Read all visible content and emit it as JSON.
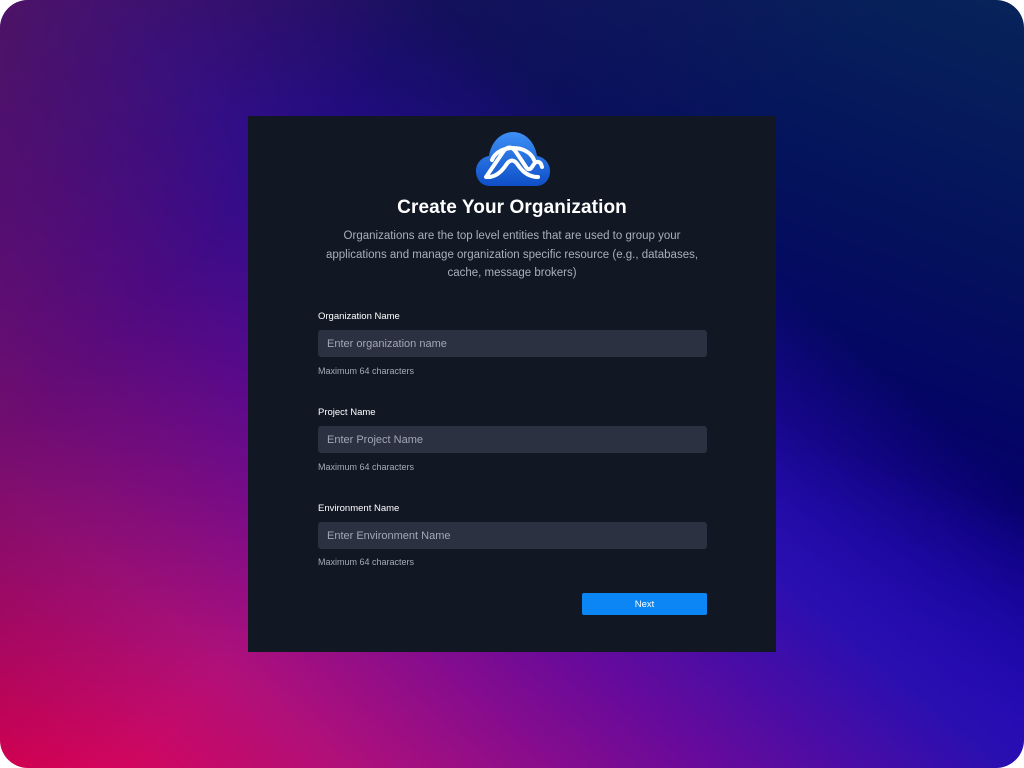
{
  "dialog": {
    "title": "Create Your Organization",
    "description": "Organizations are the top level entities that are used to group your applications and manage organization specific resource (e.g., databases, cache, message brokers)",
    "logo_icon": "cloud-logo-icon"
  },
  "form": {
    "fields": [
      {
        "label": "Organization Name",
        "placeholder": "Enter organization name",
        "value": "",
        "hint": "Maximum 64 characters"
      },
      {
        "label": "Project Name",
        "placeholder": "Enter Project Name",
        "value": "",
        "hint": "Maximum 64 characters"
      },
      {
        "label": "Environment Name",
        "placeholder": "Enter Environment Name",
        "value": "",
        "hint": "Maximum 64 characters"
      }
    ],
    "next_label": "Next"
  },
  "colors": {
    "card_background": "#111723",
    "input_background": "#2c3142",
    "primary_button": "#0d86f5",
    "logo_blue": "#1f6fe0"
  }
}
